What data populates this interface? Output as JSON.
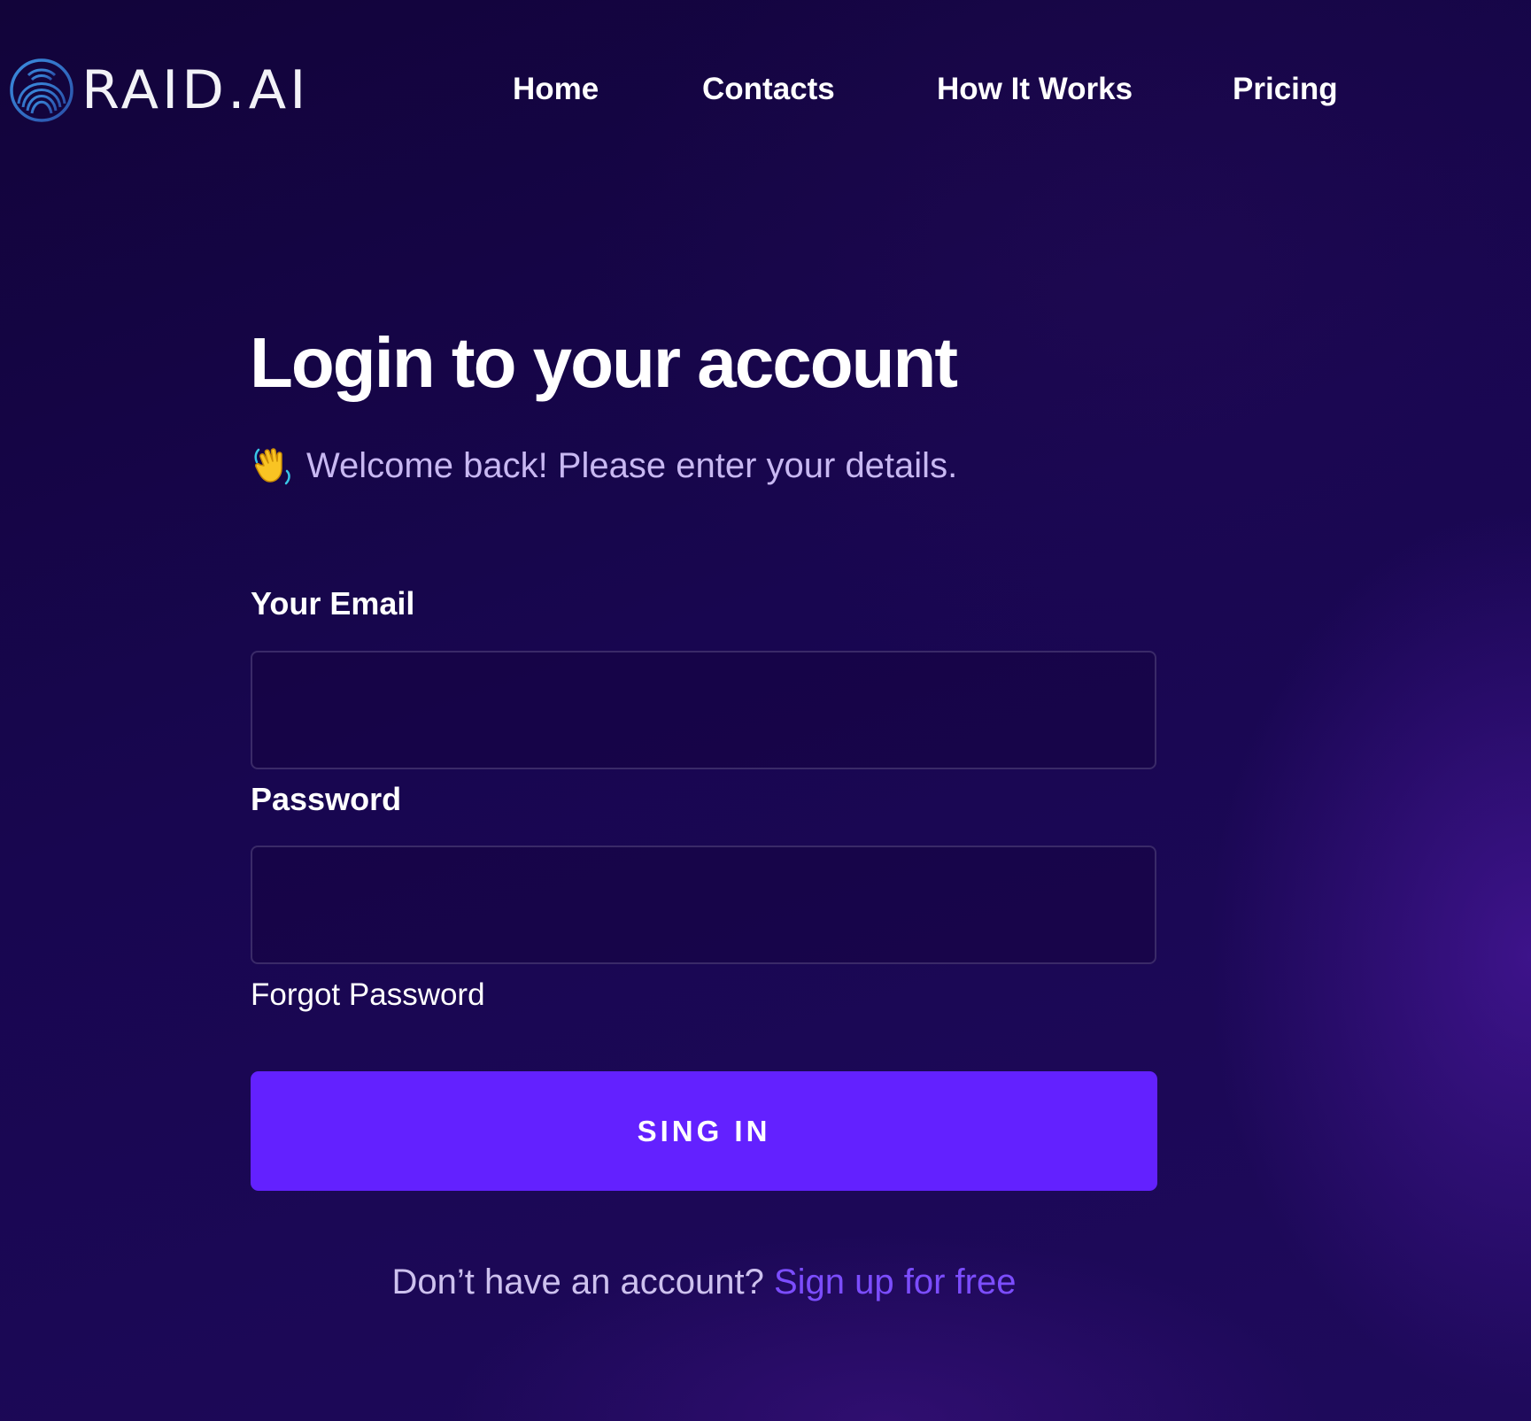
{
  "brand": {
    "name": "RAID.AI",
    "logo_icon": "concentric-rings-logo-icon"
  },
  "nav": {
    "items": [
      {
        "label": "Home"
      },
      {
        "label": "Contacts"
      },
      {
        "label": "How It Works"
      },
      {
        "label": "Pricing"
      }
    ]
  },
  "login": {
    "title": "Login to your account",
    "subtitle_icon": "waving-hand-icon",
    "subtitle": "Welcome back! Please enter your details.",
    "email": {
      "label": "Your Email",
      "value": "",
      "placeholder": ""
    },
    "password": {
      "label": "Password",
      "value": "",
      "placeholder": ""
    },
    "forgot_label": "Forgot Password",
    "submit_label": "SING IN",
    "signup_prompt": "Don’t have an account?",
    "signup_link": "Sign up for free"
  },
  "colors": {
    "background": "#14053a",
    "accent": "#6321ff",
    "link": "#7c4dff",
    "subtitle": "#c8b8f2",
    "logo_ring": "#2f6bd8"
  }
}
